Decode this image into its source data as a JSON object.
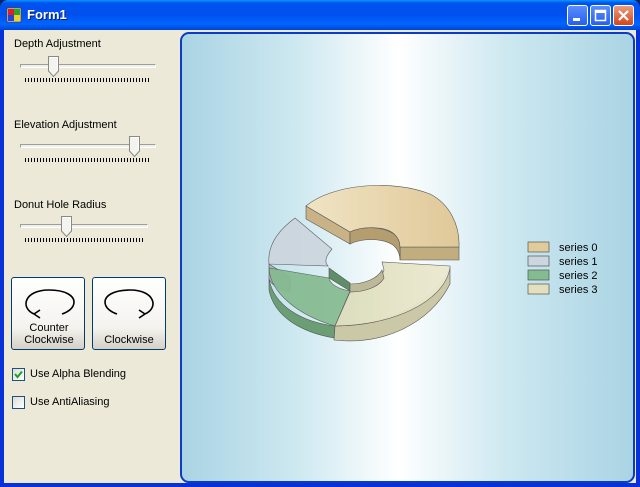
{
  "window": {
    "title": "Form1"
  },
  "controls": {
    "depth_label": "Depth Adjustment",
    "depth_value": 0.22,
    "elevation_label": "Elevation Adjustment",
    "elevation_value": 0.87,
    "donut_label": "Donut Hole Radius",
    "donut_value": 0.35,
    "ccw_button_label": "Counter Clockwise",
    "cw_button_label": "Clockwise",
    "alpha_label": "Use Alpha Blending",
    "alpha_checked": true,
    "antialias_label": "Use AntiAliasing",
    "antialias_checked": false
  },
  "chart_data": {
    "type": "pie",
    "style": "3d-donut",
    "series_names": [
      "series 0",
      "series 1",
      "series 2",
      "series 3"
    ],
    "colors": [
      "#e0cc9b",
      "#ccd6df",
      "#85bb90",
      "#e4e0bd"
    ],
    "legend_position": "right"
  }
}
